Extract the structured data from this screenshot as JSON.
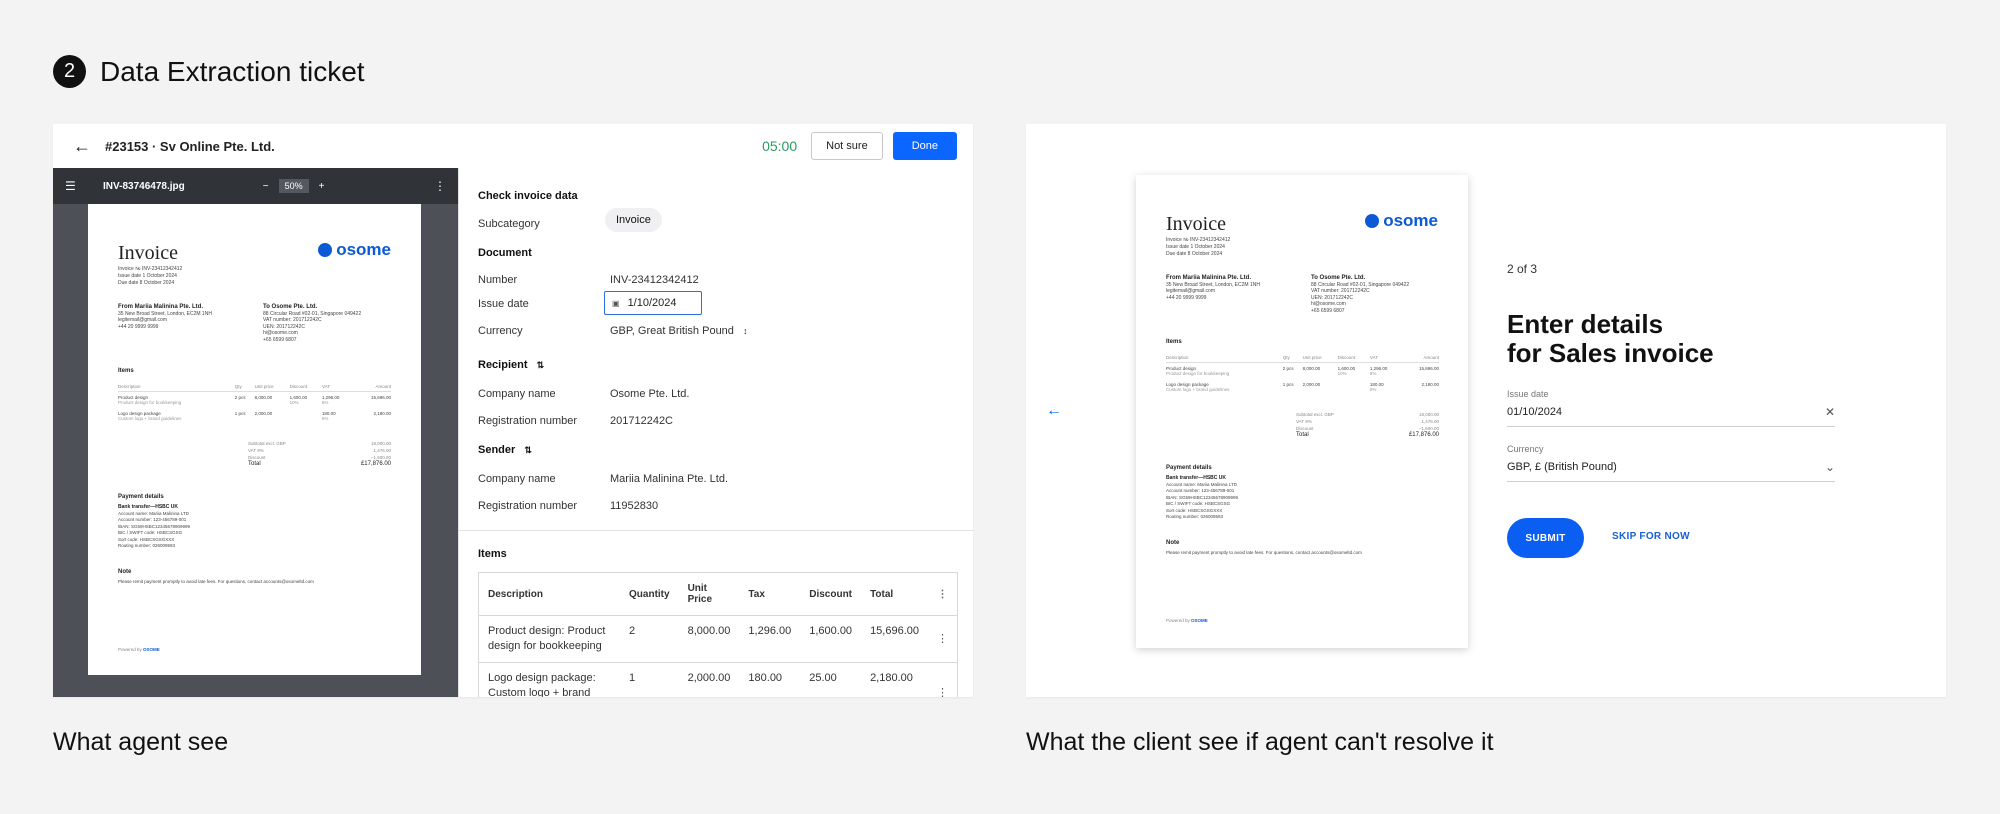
{
  "step": {
    "number": "2",
    "title": "Data Extraction ticket"
  },
  "captions": {
    "left": "What agent see",
    "right": "What the client see if agent can't resolve it"
  },
  "agent": {
    "ticket_title": "#23153 · Sv Online Pte. Ltd.",
    "timer": "05:00",
    "not_sure_label": "Not sure",
    "done_label": "Done",
    "viewer": {
      "file_name": "INV-83746478.jpg",
      "zoom": "50%",
      "minus": "−",
      "plus": "+"
    },
    "form": {
      "title": "Check invoice data",
      "subcategory_label": "Subcategory",
      "subcategory_value": "Invoice",
      "document_section": "Document",
      "number_label": "Number",
      "number_value": "INV-23412342412",
      "issue_date_label": "Issue date",
      "issue_date_value": "1/10/2024",
      "currency_label": "Currency",
      "currency_value": "GBP, Great British Pound",
      "recipient_section": "Recipient",
      "recipient_company_label": "Company name",
      "recipient_company_value": "Osome Pte. Ltd.",
      "recipient_reg_label": "Registration number",
      "recipient_reg_value": "201712242C",
      "sender_section": "Sender",
      "sender_company_label": "Company name",
      "sender_company_value": "Mariia Malinina Pte. Ltd.",
      "sender_reg_label": "Registration number",
      "sender_reg_value": "11952830",
      "items_section": "Items",
      "items_headers": [
        "Description",
        "Quantity",
        "Unit Price",
        "Tax",
        "Discount",
        "Total"
      ],
      "items_rows": [
        {
          "description": "Product design: Product design for bookkeeping",
          "quantity": "2",
          "unit_price": "8,000.00",
          "tax": "1,296.00",
          "discount": "1,600.00",
          "total": "15,696.00"
        },
        {
          "description": "Logo design package: Custom logo + brand guidelines",
          "quantity": "1",
          "unit_price": "2,000.00",
          "tax": "180.00",
          "discount": "25.00",
          "total": "2,180.00"
        }
      ]
    }
  },
  "invoice_doc": {
    "title": "Invoice",
    "logo": "osome",
    "meta": [
      "Invoice №    INV-23412342412",
      "Issue date    1 October 2024",
      "Due date    8 October 2024"
    ],
    "from_title": "From Mariia Malinina Pte. Ltd.",
    "from_lines": [
      "35 New Broad Street, London, EC2M 1NH",
      "legitemail@gmail.com",
      "+44 20 9999 9999"
    ],
    "to_title": "To Osome Pte. Ltd.",
    "to_lines": [
      "88 Circular Road #02-01, Singapore 049422",
      "VAT number: 201712242C",
      "UEN: 201712242C",
      "hi@osome.com",
      "+65 6599 6807"
    ],
    "items_title": "Items",
    "table_headers": [
      "Description",
      "Qty",
      "Unit price",
      "Discount",
      "VAT",
      "Amount"
    ],
    "table_rows": [
      {
        "desc": "Product design",
        "sub": "Product design for bookkeeping",
        "qty": "2 pcs",
        "unit": "8,000.00",
        "disc": "1,600.00",
        "disc_pct": "10%",
        "vat": "1,296.00",
        "vat_pct": "8%",
        "amount": "15,696.00"
      },
      {
        "desc": "Logo design package",
        "sub": "Custom logo + brand guidelines",
        "qty": "1 pcs",
        "unit": "2,000.00",
        "disc": "",
        "disc_pct": "",
        "vat": "180.00",
        "vat_pct": "9%",
        "amount": "2,180.00"
      }
    ],
    "summary": [
      {
        "label": "Subtotal excl. GBP",
        "value": "18,000.00"
      },
      {
        "label": "VAT 9%",
        "value": "1,476.00"
      },
      {
        "label": "Discount",
        "value": "−1,600.00"
      }
    ],
    "total_label": "Total",
    "total_value": "£17,876.00",
    "payment_title": "Payment details",
    "payment_lines": [
      "Bank transfer—HSBC UK",
      "Account name: Mariia Malinina LTD",
      "Account number: 123-456789-001",
      "IBAN: SG59HSBC12345678909999",
      "BIC / SWIFT code: HSBCSGSG",
      "Sort code: HSBCSGSGXXX",
      "Routing number: 026009593"
    ],
    "note_title": "Note",
    "note_text": "Please remit payment promptly to avoid late fees. For questions, contact accounts@osomeltd.com",
    "powered_by": "Powered by",
    "powered_brand": "OSOME"
  },
  "client": {
    "progress": "2 of 3",
    "title_line1": "Enter details",
    "title_line2": "for Sales invoice",
    "issue_date_label": "Issue date",
    "issue_date_value": "01/10/2024",
    "currency_label": "Currency",
    "currency_value": "GBP, £ (British Pound)",
    "submit_label": "SUBMIT",
    "skip_label": "SKIP FOR NOW"
  },
  "colors": {
    "primary": "#0a66ff",
    "timer": "#2b9b5f",
    "brand": "#0a5ad6"
  }
}
